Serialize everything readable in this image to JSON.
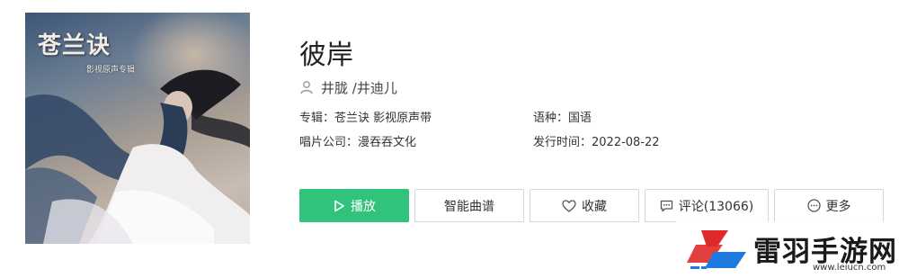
{
  "cover": {
    "title": "苍兰诀",
    "subtitle": "影视原声专辑"
  },
  "song": {
    "title": "彼岸",
    "artists": "井胧 /井迪儿"
  },
  "meta": {
    "album_label": "专辑：",
    "album_value": "苍兰诀 影视原声带",
    "language_label": "语种：",
    "language_value": "国语",
    "company_label": "唱片公司：",
    "company_value": "漫吞吞文化",
    "release_label": "发行时间：",
    "release_value": "2022-08-22"
  },
  "actions": {
    "play": "播放",
    "score": "智能曲谱",
    "favorite": "收藏",
    "comment": "评论(13066)",
    "more": "更多"
  },
  "watermark": {
    "name": "雷羽手游网",
    "url": "www.leiucn.com"
  },
  "colors": {
    "primary": "#31c27c",
    "watermark_red": "#e02a2a",
    "watermark_blue": "#1d7be0"
  }
}
